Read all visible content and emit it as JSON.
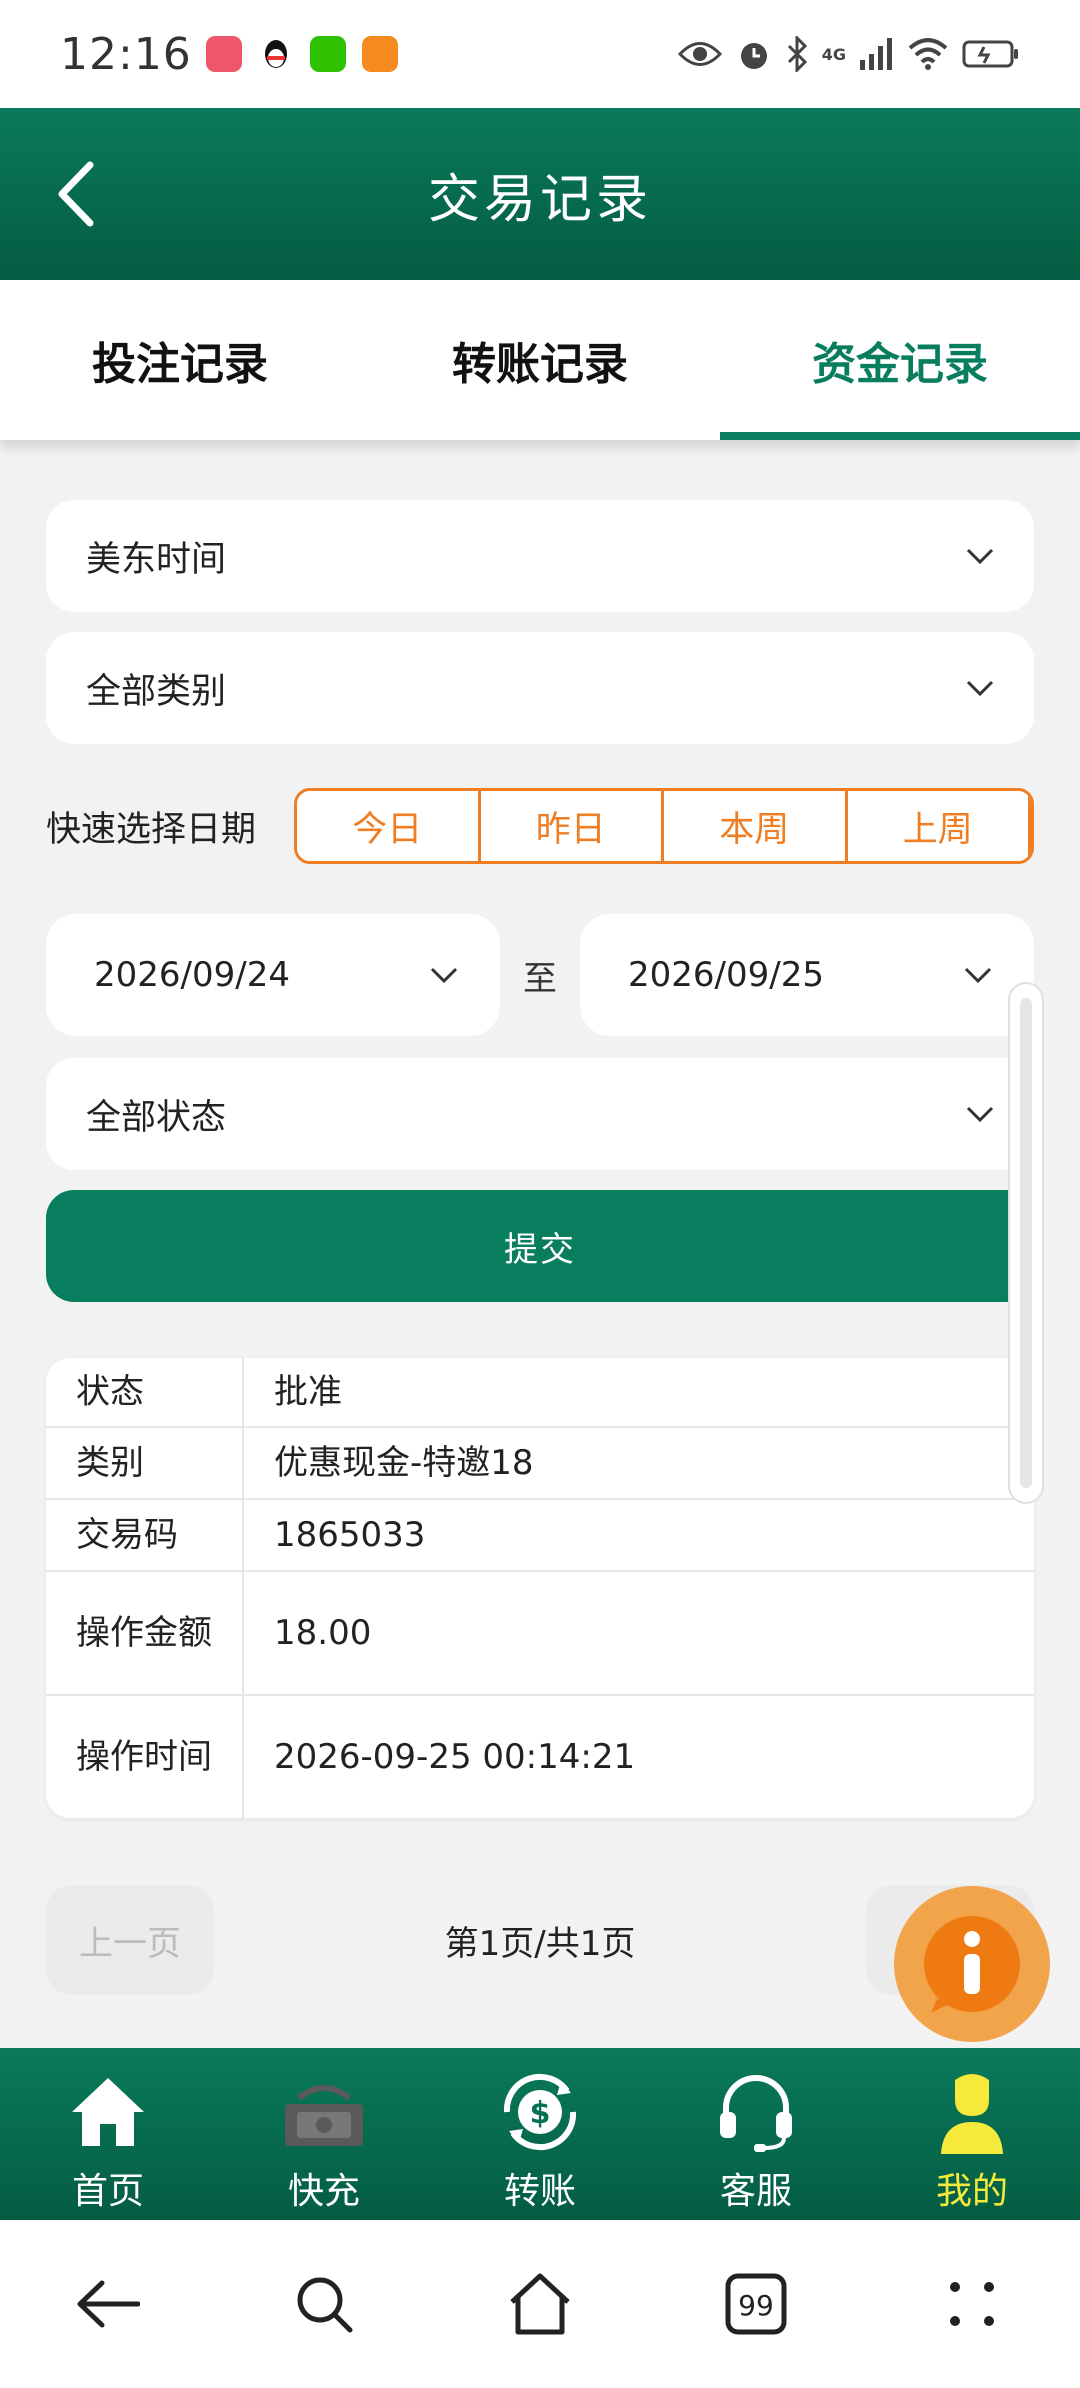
{
  "status_bar": {
    "time": "12:16",
    "network": "4G"
  },
  "header": {
    "title": "交易记录"
  },
  "tabs": [
    {
      "label": "投注记录"
    },
    {
      "label": "转账记录"
    },
    {
      "label": "资金记录"
    }
  ],
  "filters": {
    "timezone": "美东时间",
    "category": "全部类别",
    "quick_label": "快速选择日期",
    "quick_options": [
      "今日",
      "昨日",
      "本周",
      "上周"
    ],
    "start_date": "2026/09/24",
    "separator": "至",
    "end_date": "2026/09/25",
    "status": "全部状态",
    "submit_label": "提交"
  },
  "record": {
    "rows": [
      {
        "key": "状态",
        "value": "批准"
      },
      {
        "key": "类别",
        "value": "优惠现金-特邀18"
      },
      {
        "key": "交易码",
        "value": "1865033"
      },
      {
        "key": "操作金额",
        "value": "18.00"
      },
      {
        "key": "操作时间",
        "value": "2026-09-25 00:14:21"
      }
    ]
  },
  "pager": {
    "prev_label": "上一页",
    "info": "第1页/共1页"
  },
  "bottom_tabs": [
    {
      "label": "首页"
    },
    {
      "label": "快充"
    },
    {
      "label": "转账"
    },
    {
      "label": "客服"
    },
    {
      "label": "我的"
    }
  ],
  "colors": {
    "brand_green": "#087e5e",
    "accent_orange": "#ee7d23",
    "active_yellow": "#f5e93c"
  }
}
